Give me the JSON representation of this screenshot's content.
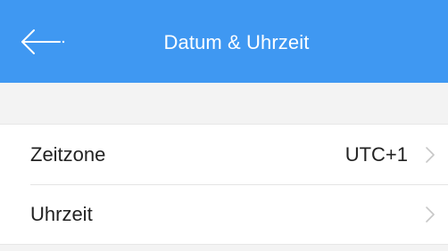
{
  "header": {
    "title": "Datum & Uhrzeit",
    "back_icon": "arrow-left-icon"
  },
  "settings": {
    "rows": [
      {
        "label": "Zeitzone",
        "value": "UTC+1",
        "icon": "chevron-right-icon"
      },
      {
        "label": "Uhrzeit",
        "value": "",
        "icon": "chevron-right-icon"
      }
    ]
  },
  "colors": {
    "header_background": "#3f98f2",
    "page_background": "#f3f3f3",
    "row_background": "#ffffff",
    "text_primary": "#222222",
    "chevron": "#c7c7c7",
    "divider": "#e5e5e5"
  }
}
